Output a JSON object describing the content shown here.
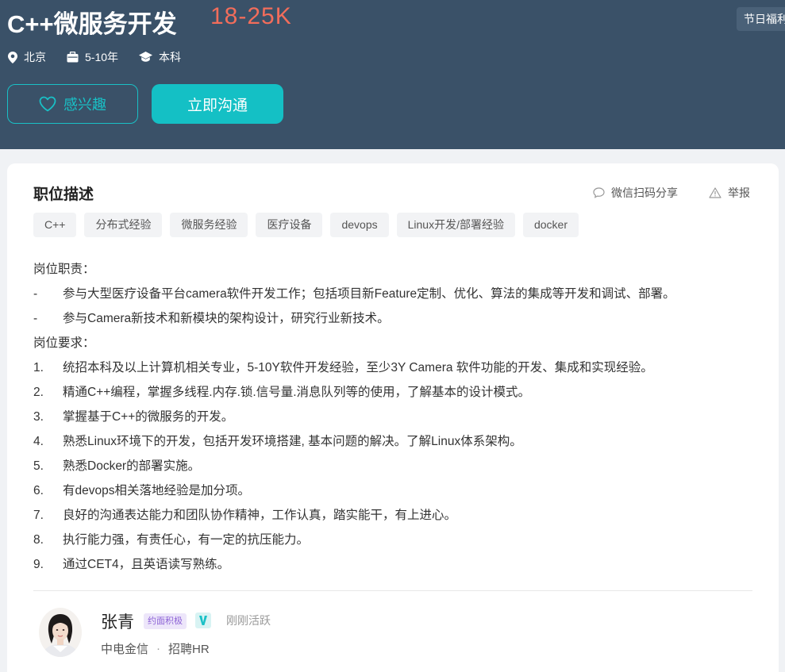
{
  "job": {
    "title": "C++微服务开发",
    "salary": "18-25K",
    "benefit_tag": "节日福利",
    "meta": {
      "location": "北京",
      "experience": "5-10年",
      "education": "本科"
    },
    "buttons": {
      "interest": "感兴趣",
      "chat": "立即沟通"
    }
  },
  "card": {
    "section_title": "职位描述",
    "share_label": "微信扫码分享",
    "report_label": "举报",
    "tags": [
      "C++",
      "分布式经验",
      "微服务经验",
      "医疗设备",
      "devops",
      "Linux开发/部署经验",
      "docker"
    ],
    "description": [
      {
        "num": "",
        "text": "岗位职责："
      },
      {
        "num": "-",
        "text": "参与大型医疗设备平台camera软件开发工作；包括项目新Feature定制、优化、算法的集成等开发和调试、部署。"
      },
      {
        "num": "-",
        "text": "参与Camera新技术和新模块的架构设计，研究行业新技术。"
      },
      {
        "num": "",
        "text": "岗位要求："
      },
      {
        "num": "1.",
        "text": "统招本科及以上计算机相关专业，5-10Y软件开发经验，至少3Y Camera 软件功能的开发、集成和实现经验。"
      },
      {
        "num": "2.",
        "text": "精通C++编程，掌握多线程.内存.锁.信号量.消息队列等的使用，了解基本的设计模式。"
      },
      {
        "num": "3.",
        "text": "掌握基于C++的微服务的开发。"
      },
      {
        "num": "4.",
        "text": "熟悉Linux环境下的开发，包括开发环境搭建, 基本问题的解决。了解Linux体系架构。"
      },
      {
        "num": "5.",
        "text": "熟悉Docker的部署实施。"
      },
      {
        "num": "6.",
        "text": "有devops相关落地经验是加分项。"
      },
      {
        "num": "7.",
        "text": "良好的沟通表达能力和团队协作精神，工作认真，踏实能干，有上进心。"
      },
      {
        "num": "8.",
        "text": "执行能力强，有责任心，有一定的抗压能力。"
      },
      {
        "num": "9.",
        "text": "通过CET4，且英语读写熟练。"
      }
    ]
  },
  "recruiter": {
    "name": "张青",
    "badge": "约面积极",
    "v_badge": "V",
    "status": "刚刚活跃",
    "company": "中电金信",
    "separator": "·",
    "role": "招聘HR"
  },
  "colors": {
    "header_bg": "#3a5168",
    "accent": "#14c0c5",
    "salary": "#f26d5b"
  }
}
